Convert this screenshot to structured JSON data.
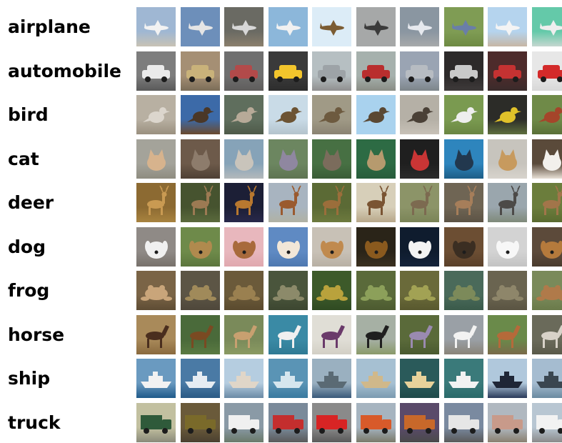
{
  "classes": [
    {
      "label": "airplane",
      "images": [
        {
          "subject": "airplane",
          "bg": "#9fb7d3",
          "ground": "#c8c2b4",
          "shape": "#f2f2f2"
        },
        {
          "subject": "airplane",
          "bg": "#6d8fba",
          "ground": "#6d8fba",
          "shape": "#e5e5e5"
        },
        {
          "subject": "airplane",
          "bg": "#6a6a63",
          "ground": "#8b7f6d",
          "shape": "#d7d7d7"
        },
        {
          "subject": "airplane",
          "bg": "#8cb7da",
          "ground": "#8cb7da",
          "shape": "#f1f1f1"
        },
        {
          "subject": "airplane",
          "bg": "#dcecf7",
          "ground": "#dcecf7",
          "shape": "#7b5c33"
        },
        {
          "subject": "airplane",
          "bg": "#a6a8a8",
          "ground": "#a6a8a8",
          "shape": "#3b3b3b"
        },
        {
          "subject": "airplane",
          "bg": "#8a96a1",
          "ground": "#a7a9aa",
          "shape": "#e6e9ee"
        },
        {
          "subject": "airplane",
          "bg": "#7f9c54",
          "ground": "#6e8a43",
          "shape": "#6a7ea8"
        },
        {
          "subject": "airplane",
          "bg": "#b5d4ee",
          "ground": "#c7b6a4",
          "shape": "#f4f4f4"
        },
        {
          "subject": "airplane",
          "bg": "#64c9a9",
          "ground": "#c5d7d0",
          "shape": "#eeeeee"
        }
      ]
    },
    {
      "label": "automobile",
      "images": [
        {
          "subject": "automobile",
          "bg": "#7d7d7d",
          "ground": "#5a5a5a",
          "shape": "#eaeaea"
        },
        {
          "subject": "automobile",
          "bg": "#a58f74",
          "ground": "#7b6d58",
          "shape": "#c9b27a"
        },
        {
          "subject": "automobile",
          "bg": "#6f6f6f",
          "ground": "#5f5d5c",
          "shape": "#b24a4a"
        },
        {
          "subject": "automobile",
          "bg": "#3a3a3a",
          "ground": "#2d2d2d",
          "shape": "#f3c52c"
        },
        {
          "subject": "automobile",
          "bg": "#b6bfc2",
          "ground": "#8f8f8f",
          "shape": "#9da3a7"
        },
        {
          "subject": "automobile",
          "bg": "#a6b1ad",
          "ground": "#8a8d85",
          "shape": "#b92e2e"
        },
        {
          "subject": "automobile",
          "bg": "#9aa4b3",
          "ground": "#7d858a",
          "shape": "#b7bcc2"
        },
        {
          "subject": "automobile",
          "bg": "#2d2a2a",
          "ground": "#3e3a3a",
          "shape": "#c9c9c9"
        },
        {
          "subject": "automobile",
          "bg": "#4d2b2b",
          "ground": "#3a2b2b",
          "shape": "#c43232"
        },
        {
          "subject": "automobile",
          "bg": "#e7e7e7",
          "ground": "#d7d7d7",
          "shape": "#d32a2a"
        }
      ]
    },
    {
      "label": "bird",
      "images": [
        {
          "subject": "bird",
          "bg": "#b8b0a2",
          "ground": "#9a907f",
          "shape": "#dcd6cd"
        },
        {
          "subject": "bird",
          "bg": "#3c6aa8",
          "ground": "#6b4a2d",
          "shape": "#4a3727"
        },
        {
          "subject": "bird",
          "bg": "#5f6e5d",
          "ground": "#4e5a49",
          "shape": "#b7aa98"
        },
        {
          "subject": "bird",
          "bg": "#c9dbe7",
          "ground": "#b4c3cc",
          "shape": "#6c5333"
        },
        {
          "subject": "bird",
          "bg": "#a09a86",
          "ground": "#8b8373",
          "shape": "#6d5a3f"
        },
        {
          "subject": "bird",
          "bg": "#a9d2ee",
          "ground": "#a9d2ee",
          "shape": "#5a4833"
        },
        {
          "subject": "bird",
          "bg": "#b5b0a6",
          "ground": "#c7c1b7",
          "shape": "#4a4036"
        },
        {
          "subject": "bird",
          "bg": "#7a9a50",
          "ground": "#6a8642",
          "shape": "#eeeeee"
        },
        {
          "subject": "bird",
          "bg": "#2c2c28",
          "ground": "#5e6f3e",
          "shape": "#e0c12a"
        },
        {
          "subject": "bird",
          "bg": "#6f8a48",
          "ground": "#5a7038",
          "shape": "#a5452a"
        }
      ]
    },
    {
      "label": "cat",
      "images": [
        {
          "subject": "cat",
          "bg": "#a4a39a",
          "ground": "#8f8c80",
          "shape": "#d7b38d"
        },
        {
          "subject": "cat",
          "bg": "#6d5a4a",
          "ground": "#4e4035",
          "shape": "#8d7c6c"
        },
        {
          "subject": "cat",
          "bg": "#86a3b8",
          "ground": "#b4b9bb",
          "shape": "#c9c4bb"
        },
        {
          "subject": "cat",
          "bg": "#6c8660",
          "ground": "#5e7452",
          "shape": "#8f87a0"
        },
        {
          "subject": "cat",
          "bg": "#477043",
          "ground": "#3a5c37",
          "shape": "#7b6c5c"
        },
        {
          "subject": "cat",
          "bg": "#2d6b44",
          "ground": "#285c3b",
          "shape": "#b69a6e"
        },
        {
          "subject": "cat",
          "bg": "#1f1f1f",
          "ground": "#2b2b2b",
          "shape": "#c93535"
        },
        {
          "subject": "cat",
          "bg": "#2e85bd",
          "ground": "#1d5e87",
          "shape": "#22384e"
        },
        {
          "subject": "cat",
          "bg": "#c7c4bd",
          "ground": "#d7d3cc",
          "shape": "#c79a5e"
        },
        {
          "subject": "cat",
          "bg": "#5a4a3a",
          "ground": "#e8e0d6",
          "shape": "#f2f0ec"
        }
      ]
    },
    {
      "label": "deer",
      "images": [
        {
          "subject": "deer",
          "bg": "#8c6a32",
          "ground": "#a8833f",
          "shape": "#c99a52"
        },
        {
          "subject": "deer",
          "bg": "#46532f",
          "ground": "#5a6a3c",
          "shape": "#9c7a53"
        },
        {
          "subject": "deer",
          "bg": "#1c1f36",
          "ground": "#28284a",
          "shape": "#b8782f"
        },
        {
          "subject": "deer",
          "bg": "#a8b4c0",
          "ground": "#b0b2a4",
          "shape": "#9a5a2f"
        },
        {
          "subject": "deer",
          "bg": "#5b6a35",
          "ground": "#6d7a3e",
          "shape": "#9b6e3b"
        },
        {
          "subject": "deer",
          "bg": "#d7cfb9",
          "ground": "#b8a88a",
          "shape": "#7a5433"
        },
        {
          "subject": "deer",
          "bg": "#8c9468",
          "ground": "#7a8457",
          "shape": "#7c6a50"
        },
        {
          "subject": "deer",
          "bg": "#6f6554",
          "ground": "#5c5345",
          "shape": "#a67e5a"
        },
        {
          "subject": "deer",
          "bg": "#9aa6ad",
          "ground": "#7f8a7a",
          "shape": "#4c4a48"
        },
        {
          "subject": "deer",
          "bg": "#6b7d3c",
          "ground": "#5a6b30",
          "shape": "#a2754a"
        }
      ]
    },
    {
      "label": "dog",
      "images": [
        {
          "subject": "dog",
          "bg": "#8f8a86",
          "ground": "#77716b",
          "shape": "#f0f0f0"
        },
        {
          "subject": "dog",
          "bg": "#6e8a4a",
          "ground": "#5c763d",
          "shape": "#b08a4e"
        },
        {
          "subject": "dog",
          "bg": "#e8b7bd",
          "ground": "#e0a8ae",
          "shape": "#a86a3c"
        },
        {
          "subject": "dog",
          "bg": "#5f8ac3",
          "ground": "#4e78b0",
          "shape": "#f2e7d8"
        },
        {
          "subject": "dog",
          "bg": "#c8c1b6",
          "ground": "#b8b0a4",
          "shape": "#c08a4e"
        },
        {
          "subject": "dog",
          "bg": "#2a2418",
          "ground": "#3a3020",
          "shape": "#8a5a1e"
        },
        {
          "subject": "dog",
          "bg": "#0f1c2e",
          "ground": "#14233a",
          "shape": "#f3f3f3"
        },
        {
          "subject": "dog",
          "bg": "#6c4e33",
          "ground": "#5a402a",
          "shape": "#3b2e22"
        },
        {
          "subject": "dog",
          "bg": "#d3d3d3",
          "ground": "#c3c3c3",
          "shape": "#f7f7f7"
        },
        {
          "subject": "dog",
          "bg": "#5c4a3a",
          "ground": "#4a3b2e",
          "shape": "#b57a3c"
        }
      ]
    },
    {
      "label": "frog",
      "images": [
        {
          "subject": "frog",
          "bg": "#7a6446",
          "ground": "#5e4c34",
          "shape": "#c9a57a"
        },
        {
          "subject": "frog",
          "bg": "#5c5545",
          "ground": "#4e473a",
          "shape": "#a08a5a"
        },
        {
          "subject": "frog",
          "bg": "#6b5a3a",
          "ground": "#5a4a2e",
          "shape": "#9a8050"
        },
        {
          "subject": "frog",
          "bg": "#4a553c",
          "ground": "#3c4630",
          "shape": "#8c8a6a"
        },
        {
          "subject": "frog",
          "bg": "#3d5a2a",
          "ground": "#2f4a22",
          "shape": "#b9a23c"
        },
        {
          "subject": "frog",
          "bg": "#5a6a3a",
          "ground": "#4c5a30",
          "shape": "#8ca05a"
        },
        {
          "subject": "frog",
          "bg": "#6a6a3a",
          "ground": "#58582e",
          "shape": "#a2a254"
        },
        {
          "subject": "frog",
          "bg": "#4a6a5a",
          "ground": "#3a5a4a",
          "shape": "#7c8a5a"
        },
        {
          "subject": "frog",
          "bg": "#6a6450",
          "ground": "#5a5442",
          "shape": "#8e866a"
        },
        {
          "subject": "frog",
          "bg": "#7a8a5a",
          "ground": "#6a7a4a",
          "shape": "#b07a4a"
        }
      ]
    },
    {
      "label": "horse",
      "images": [
        {
          "subject": "horse",
          "bg": "#a98a5a",
          "ground": "#8a6a3e",
          "shape": "#4a2e1e"
        },
        {
          "subject": "horse",
          "bg": "#4a6a3a",
          "ground": "#5a7a42",
          "shape": "#7a4a22"
        },
        {
          "subject": "horse",
          "bg": "#7a8a5a",
          "ground": "#8a9a62",
          "shape": "#c8a070"
        },
        {
          "subject": "horse",
          "bg": "#3a8aa5",
          "ground": "#2f7a94",
          "shape": "#f0f0f0"
        },
        {
          "subject": "horse",
          "bg": "#e0ded6",
          "ground": "#d2cfc5",
          "shape": "#6a3a6a"
        },
        {
          "subject": "horse",
          "bg": "#a6b0a4",
          "ground": "#8a9a6a",
          "shape": "#1f1f1f"
        },
        {
          "subject": "horse",
          "bg": "#5a6a3a",
          "ground": "#4a5a30",
          "shape": "#9a8ab0"
        },
        {
          "subject": "horse",
          "bg": "#9aa0a6",
          "ground": "#8a8478",
          "shape": "#f2f2f2"
        },
        {
          "subject": "horse",
          "bg": "#6a8a4a",
          "ground": "#7a6a4a",
          "shape": "#b56a3a"
        },
        {
          "subject": "horse",
          "bg": "#6a6a5a",
          "ground": "#5a5a4a",
          "shape": "#d8d2c8"
        }
      ]
    },
    {
      "label": "ship",
      "images": [
        {
          "subject": "ship",
          "bg": "#6a9ac0",
          "ground": "#1f5a8a",
          "shape": "#f2f2f2"
        },
        {
          "subject": "ship",
          "bg": "#4a7aa5",
          "ground": "#2a5a85",
          "shape": "#e6ecf2"
        },
        {
          "subject": "ship",
          "bg": "#b5cde0",
          "ground": "#6a8aa5",
          "shape": "#e0d6c8"
        },
        {
          "subject": "ship",
          "bg": "#5a94b5",
          "ground": "#3a7aa0",
          "shape": "#d6e6ee"
        },
        {
          "subject": "ship",
          "bg": "#9ab0c0",
          "ground": "#3a5a7a",
          "shape": "#5a6a74"
        },
        {
          "subject": "ship",
          "bg": "#a6c0d2",
          "ground": "#7a9ab0",
          "shape": "#d0b88a"
        },
        {
          "subject": "ship",
          "bg": "#2a5a5a",
          "ground": "#1f4a4a",
          "shape": "#e8d29a"
        },
        {
          "subject": "ship",
          "bg": "#3a7a7a",
          "ground": "#2a6a6a",
          "shape": "#f2f2f2"
        },
        {
          "subject": "ship",
          "bg": "#b0c8dc",
          "ground": "#2a3a5a",
          "shape": "#1f2636"
        },
        {
          "subject": "ship",
          "bg": "#a5bcd0",
          "ground": "#6a8aa0",
          "shape": "#3a4650"
        }
      ]
    },
    {
      "label": "truck",
      "images": [
        {
          "subject": "truck",
          "bg": "#c2c0a0",
          "ground": "#8a8a7a",
          "shape": "#2f5a3a"
        },
        {
          "subject": "truck",
          "bg": "#6a5a3a",
          "ground": "#4a4030",
          "shape": "#7a6a2a"
        },
        {
          "subject": "truck",
          "bg": "#8a9aa6",
          "ground": "#6a7a6a",
          "shape": "#f0f0f0"
        },
        {
          "subject": "truck",
          "bg": "#7a8a9a",
          "ground": "#5a5a5a",
          "shape": "#c42e2e"
        },
        {
          "subject": "truck",
          "bg": "#8a8a8a",
          "ground": "#5a5a5a",
          "shape": "#d82424"
        },
        {
          "subject": "truck",
          "bg": "#a6b4c0",
          "ground": "#7a7a6a",
          "shape": "#d85a2a"
        },
        {
          "subject": "truck",
          "bg": "#5a4a6a",
          "ground": "#4a4a4a",
          "shape": "#c8682a"
        },
        {
          "subject": "truck",
          "bg": "#7a8aa0",
          "ground": "#5a5a5a",
          "shape": "#e6e6e6"
        },
        {
          "subject": "truck",
          "bg": "#b0b8c0",
          "ground": "#8a8070",
          "shape": "#c89a8a"
        },
        {
          "subject": "truck",
          "bg": "#b8c6d2",
          "ground": "#8a8a8a",
          "shape": "#f2f2f2"
        }
      ]
    }
  ]
}
